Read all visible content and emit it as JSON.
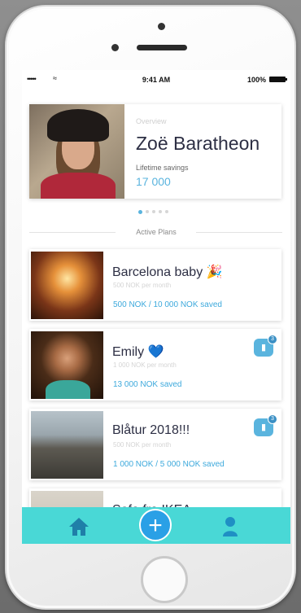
{
  "status_bar": {
    "signal": "•••••",
    "wifi": "≈",
    "time": "9:41 AM",
    "battery": "100%"
  },
  "profile": {
    "section_label": "Overview",
    "name": "Zoë Baratheon",
    "savings_label": "Lifetime savings",
    "savings_value": "17 000"
  },
  "carousel": {
    "pages": 5,
    "active": 0
  },
  "active_plans": {
    "title": "Active Plans",
    "plans": [
      {
        "title": "Barcelona baby 🎉",
        "subtitle": "500 NOK per month",
        "saved": "500 NOK / 10 000 NOK saved",
        "badge": null
      },
      {
        "title": "Emily 💙",
        "subtitle": "1 000 NOK per month",
        "saved": "13 000 NOK saved",
        "badge": "3"
      },
      {
        "title": "Blåtur 2018!!!",
        "subtitle": "500 NOK per month",
        "saved": "1 000 NOK / 5 000 NOK saved",
        "badge": "3"
      },
      {
        "title": "Sofa fra IKEA"
      }
    ]
  },
  "tabbar": {
    "home_icon": "home-icon",
    "add_label": "+",
    "profile_icon": "user-icon",
    "color": "#49d8d6",
    "accent": "#2aa0e6"
  }
}
